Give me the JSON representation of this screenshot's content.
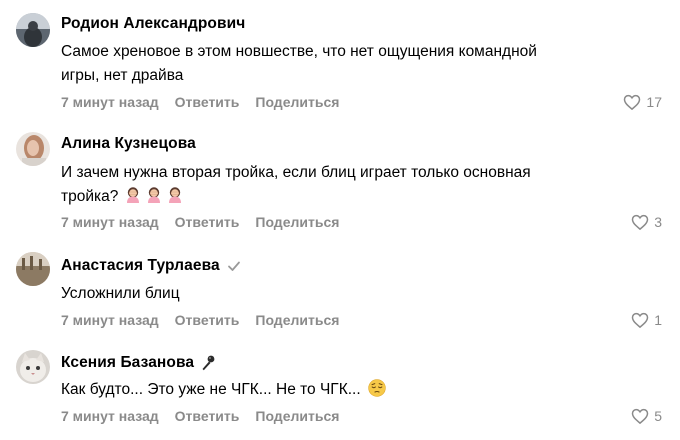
{
  "comments": [
    {
      "author": "Родион Александрович",
      "text_lines": [
        "Самое хреновое в этом новшестве, что нет ощущения командной",
        "игры, нет драйва"
      ],
      "time": "7 минут назад",
      "reply_label": "Ответить",
      "share_label": "Поделиться",
      "likes": "17"
    },
    {
      "author": "Алина Кузнецова",
      "text_lines": [
        "И зачем нужна вторая тройка, если блиц играет только основная",
        "тройка?"
      ],
      "text_emoji": "woman-facepalming-emoji x3",
      "time": "7 минут назад",
      "reply_label": "Ответить",
      "share_label": "Поделиться",
      "likes": "3"
    },
    {
      "author": "Анастасия Турлаева",
      "author_icon": "checkmark-icon",
      "text_lines": [
        "Усложнили блиц"
      ],
      "time": "7 минут назад",
      "reply_label": "Ответить",
      "share_label": "Поделиться",
      "likes": "1"
    },
    {
      "author": "Ксения Базанова",
      "author_icon": "microphone-icon",
      "text_lines": [
        "Как будто... Это уже не ЧГК... Не то ЧГК..."
      ],
      "text_emoji": "pensive-face-emoji",
      "time": "7 минут назад",
      "reply_label": "Ответить",
      "share_label": "Поделиться",
      "likes": "5"
    }
  ],
  "colors": {
    "meta_gray": "#8a8a8a",
    "text": "#000000",
    "background": "#ffffff"
  }
}
